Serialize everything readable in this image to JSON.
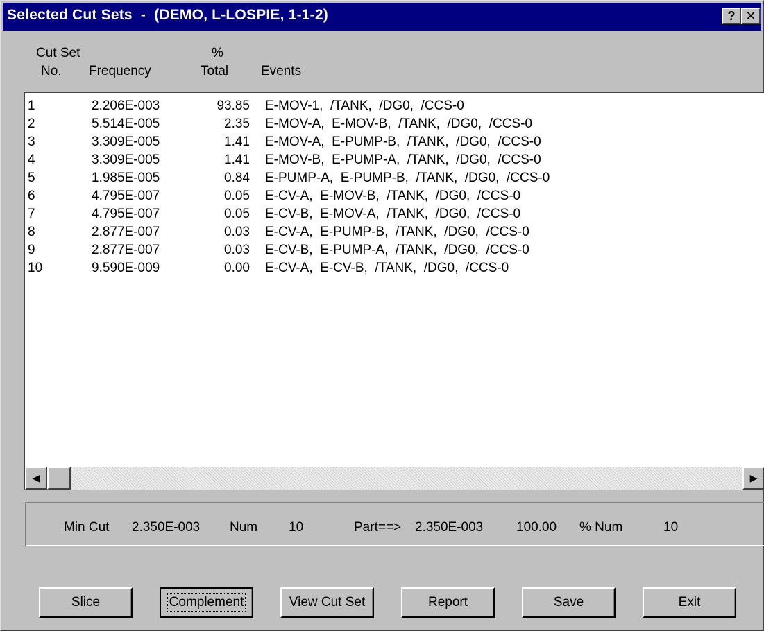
{
  "window": {
    "title": "Selected Cut Sets  -  (DEMO, L-LOSPIE, 1-1-2)",
    "help_button": "?",
    "close_button": "✕"
  },
  "columns": {
    "no_line1": "Cut Set",
    "no_line2": "No.",
    "frequency": "Frequency",
    "pct_line1": "%",
    "pct_line2": "Total",
    "events": "Events"
  },
  "rows": [
    {
      "no": "1",
      "frequency": "2.206E-003",
      "pct": "93.85",
      "events": "E-MOV-1,  /TANK,  /DG0,  /CCS-0"
    },
    {
      "no": "2",
      "frequency": "5.514E-005",
      "pct": "2.35",
      "events": "E-MOV-A,  E-MOV-B,  /TANK,  /DG0,  /CCS-0"
    },
    {
      "no": "3",
      "frequency": "3.309E-005",
      "pct": "1.41",
      "events": "E-MOV-A,  E-PUMP-B,  /TANK,  /DG0,  /CCS-0"
    },
    {
      "no": "4",
      "frequency": "3.309E-005",
      "pct": "1.41",
      "events": "E-MOV-B,  E-PUMP-A,  /TANK,  /DG0,  /CCS-0"
    },
    {
      "no": "5",
      "frequency": "1.985E-005",
      "pct": "0.84",
      "events": "E-PUMP-A,  E-PUMP-B,  /TANK,  /DG0,  /CCS-0"
    },
    {
      "no": "6",
      "frequency": "4.795E-007",
      "pct": "0.05",
      "events": "E-CV-A,  E-MOV-B,  /TANK,  /DG0,  /CCS-0"
    },
    {
      "no": "7",
      "frequency": "4.795E-007",
      "pct": "0.05",
      "events": "E-CV-B,  E-MOV-A,  /TANK,  /DG0,  /CCS-0"
    },
    {
      "no": "8",
      "frequency": "2.877E-007",
      "pct": "0.03",
      "events": "E-CV-A,  E-PUMP-B,  /TANK,  /DG0,  /CCS-0"
    },
    {
      "no": "9",
      "frequency": "2.877E-007",
      "pct": "0.03",
      "events": "E-CV-B,  E-PUMP-A,  /TANK,  /DG0,  /CCS-0"
    },
    {
      "no": "10",
      "frequency": "9.590E-009",
      "pct": "0.00",
      "events": "E-CV-A,  E-CV-B,  /TANK,  /DG0,  /CCS-0"
    }
  ],
  "summary": {
    "min_cut_label": "Min Cut",
    "min_cut_value": "2.350E-003",
    "num_label": "Num",
    "num_value": "10",
    "part_label": "Part==>",
    "part_value": "2.350E-003",
    "pct_value": "100.00",
    "pct_num_label": "% Num",
    "pct_num_value": "10"
  },
  "buttons": {
    "slice": {
      "pre": "",
      "key": "S",
      "post": "lice"
    },
    "complement": {
      "pre": "C",
      "key": "o",
      "post": "mplement"
    },
    "view_cut_set": {
      "pre": "",
      "key": "V",
      "post": "iew Cut Set"
    },
    "report": {
      "pre": "Re",
      "key": "p",
      "post": "ort"
    },
    "save": {
      "pre": "S",
      "key": "a",
      "post": "ve"
    },
    "exit": {
      "pre": "",
      "key": "E",
      "post": "xit"
    }
  },
  "icons": {
    "scroll_left": "arrow-left-icon",
    "scroll_right": "arrow-right-icon"
  }
}
